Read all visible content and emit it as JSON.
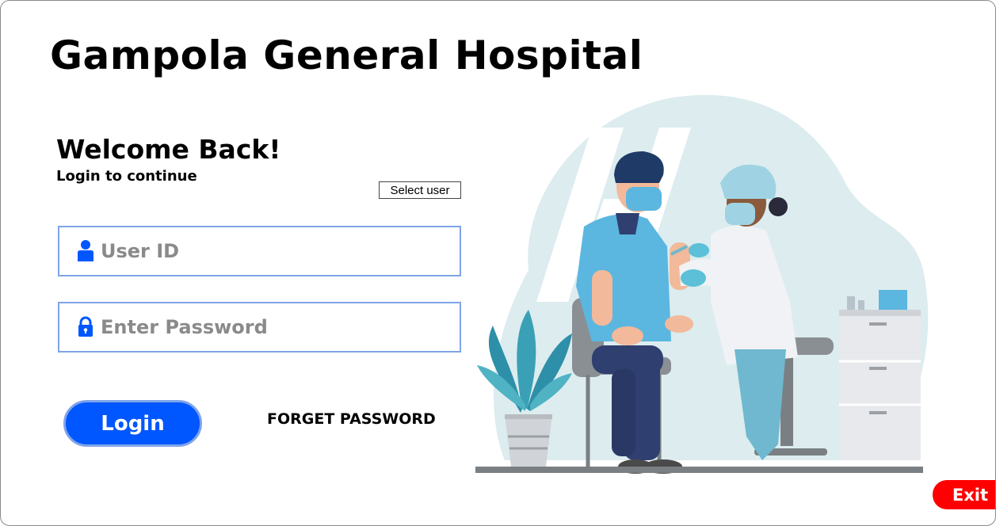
{
  "app": {
    "title": "Gampola General Hospital"
  },
  "login": {
    "heading": "Welcome Back!",
    "subheading": "Login to continue",
    "select_user_label": "Select user",
    "user_id": {
      "placeholder": "User ID",
      "value": ""
    },
    "password": {
      "placeholder": "Enter Password",
      "value": ""
    },
    "login_button": "Login",
    "forget_password": "FORGET PASSWORD"
  },
  "footer": {
    "exit_button": "Exit"
  },
  "colors": {
    "accent": "#0057ff",
    "field_border": "#7fa4e8",
    "exit": "#ff0000"
  },
  "icons": {
    "user_field": "user-icon",
    "password_field": "lock-icon"
  }
}
